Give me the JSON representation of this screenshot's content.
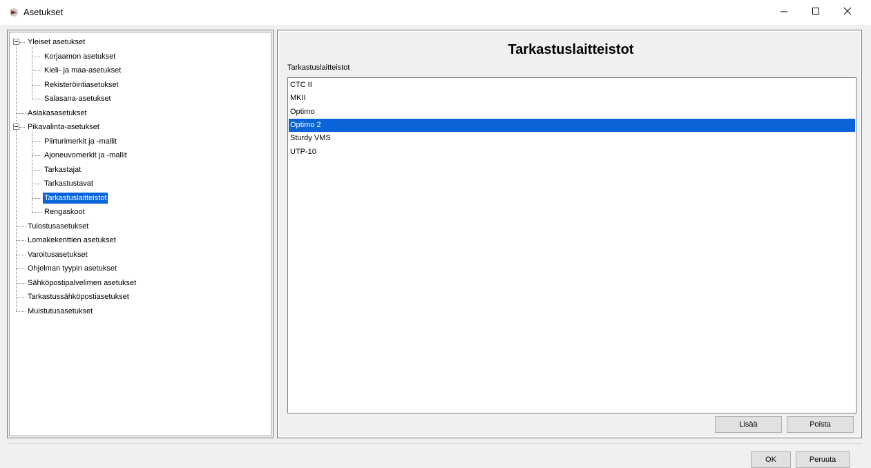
{
  "window": {
    "title": "Asetukset",
    "icon": "app-logo-icon",
    "controls": [
      "minimize-icon",
      "maximize-icon",
      "close-icon"
    ]
  },
  "tree": {
    "items": [
      {
        "label": "Yleiset asetukset",
        "level": 0,
        "expanded": true
      },
      {
        "label": "Korjaamon asetukset",
        "level": 1
      },
      {
        "label": "Kieli- ja maa-asetukset",
        "level": 1
      },
      {
        "label": "Rekisteröintiasetukset",
        "level": 1
      },
      {
        "label": "Salasana-asetukset",
        "level": 1
      },
      {
        "label": "Asiakasasetukset",
        "level": 0
      },
      {
        "label": "Pikavalinta-asetukset",
        "level": 0,
        "expanded": true
      },
      {
        "label": "Piirturimerkit ja -mallit",
        "level": 1
      },
      {
        "label": "Ajoneuvomerkit ja -mallit",
        "level": 1
      },
      {
        "label": "Tarkastajat",
        "level": 1
      },
      {
        "label": "Tarkastustavat",
        "level": 1
      },
      {
        "label": "Tarkastuslaitteistot",
        "level": 1,
        "selected": true
      },
      {
        "label": "Rengaskoot",
        "level": 1
      },
      {
        "label": "Tulostusasetukset",
        "level": 0
      },
      {
        "label": "Lomakekenttien asetukset",
        "level": 0
      },
      {
        "label": "Varoitusasetukset",
        "level": 0
      },
      {
        "label": "Ohjelman tyypin asetukset",
        "level": 0
      },
      {
        "label": "Sähköpostipalvelimen asetukset",
        "level": 0
      },
      {
        "label": "Tarkastussähköpostiasetukset",
        "level": 0
      },
      {
        "label": "Muistutusasetukset",
        "level": 0
      }
    ]
  },
  "main": {
    "title": "Tarkastuslaitteistot",
    "list_label": "Tarkastuslaitteistot",
    "list_items": [
      "CTC II",
      "MKII",
      "Optimo",
      "Optimo 2",
      "Sturdy VMS",
      "UTP-10"
    ],
    "selected_index": 3,
    "add_label": "Lisää",
    "remove_label": "Poista"
  },
  "footer": {
    "ok_label": "OK",
    "cancel_label": "Peruuta"
  },
  "colors": {
    "selection": "#0a64d7",
    "window_bg": "#f0f0f0",
    "icon_accent": "#b3262c"
  }
}
